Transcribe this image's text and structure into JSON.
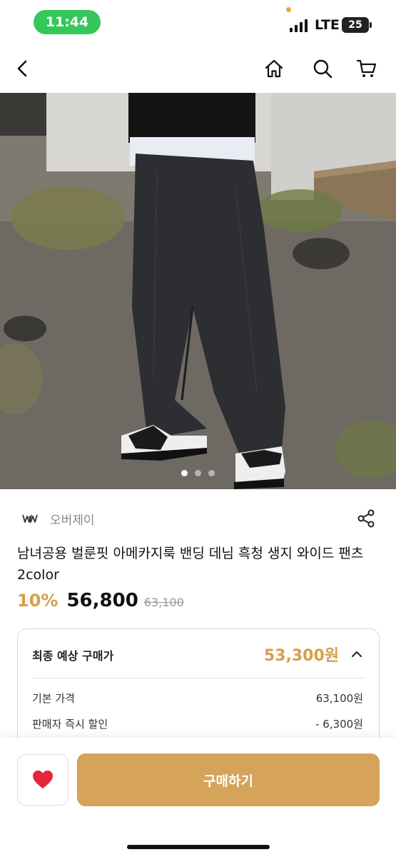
{
  "status_bar": {
    "time": "11:44",
    "network": "LTE",
    "battery": "25",
    "time_pill_color": "#34c759"
  },
  "nav": {
    "icons": [
      "back-icon",
      "home-icon",
      "search-icon",
      "cart-icon"
    ]
  },
  "carousel": {
    "total_images": 3,
    "current_index": 0
  },
  "seller": {
    "logo_text": "𝕸",
    "name": "오버제이"
  },
  "product": {
    "title": "남녀공용 벌룬핏 아메카지룩 밴딩 데님 흑청 생지 와이드 팬츠 2color",
    "discount": "10%",
    "price": "56,800",
    "original_price": "63,100"
  },
  "price_card": {
    "title": "최종 예상 구매가",
    "total": "53,300원",
    "lines": [
      {
        "label": "기본 가격",
        "value": "63,100원"
      },
      {
        "label": "판매자 즉시 할인",
        "value": "- 6,300원"
      }
    ]
  },
  "bottom": {
    "buy_label": "구매하기"
  },
  "colors": {
    "accent": "#d4a04c",
    "buy_button": "#d5a35a",
    "heart": "#e4253c"
  }
}
